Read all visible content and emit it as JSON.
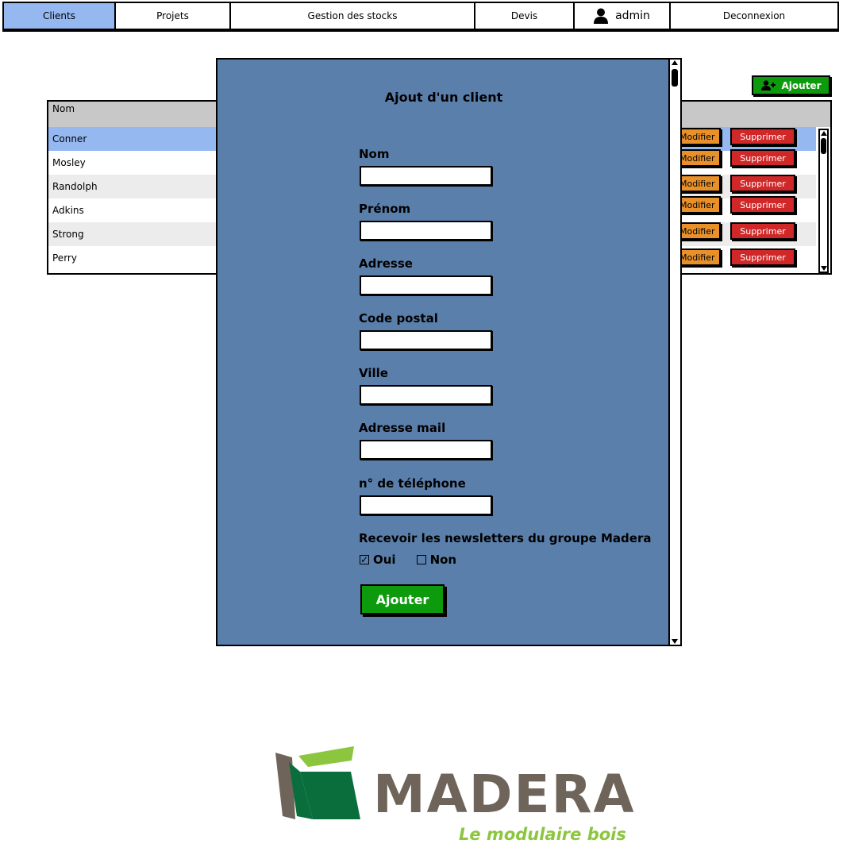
{
  "nav": {
    "items": [
      "Clients",
      "Projets",
      "Gestion des stocks",
      "Devis"
    ],
    "user": "admin",
    "logout": "Deconnexion"
  },
  "table": {
    "add_button": "Ajouter",
    "header": "Nom",
    "rows": [
      "Conner",
      "Mosley",
      "Randolph",
      "Adkins",
      "Strong",
      "Perry"
    ],
    "edit_label": "Modifier",
    "delete_label": "Supprimer"
  },
  "modal": {
    "title": "Ajout d'un client",
    "fields": [
      "Nom",
      "Prénom",
      "Adresse",
      "Code postal",
      "Ville",
      "Adresse mail",
      "n° de téléphone"
    ],
    "newsletter_label": "Recevoir les newsletters du groupe Madera",
    "option_yes": "Oui",
    "option_no": "Non",
    "yes_checked": true,
    "submit": "Ajouter"
  },
  "logo": {
    "name": "MADERA",
    "tagline": "Le modulaire bois"
  },
  "colors": {
    "nav_active": "#95b8f0",
    "modal_bg": "#5b7fab",
    "green": "#0d9b0d",
    "orange": "#e8902a",
    "red": "#d02828",
    "logo_brown": "#6e645a",
    "logo_green": "#8cc63f",
    "logo_dark_green": "#0a6e3c"
  }
}
